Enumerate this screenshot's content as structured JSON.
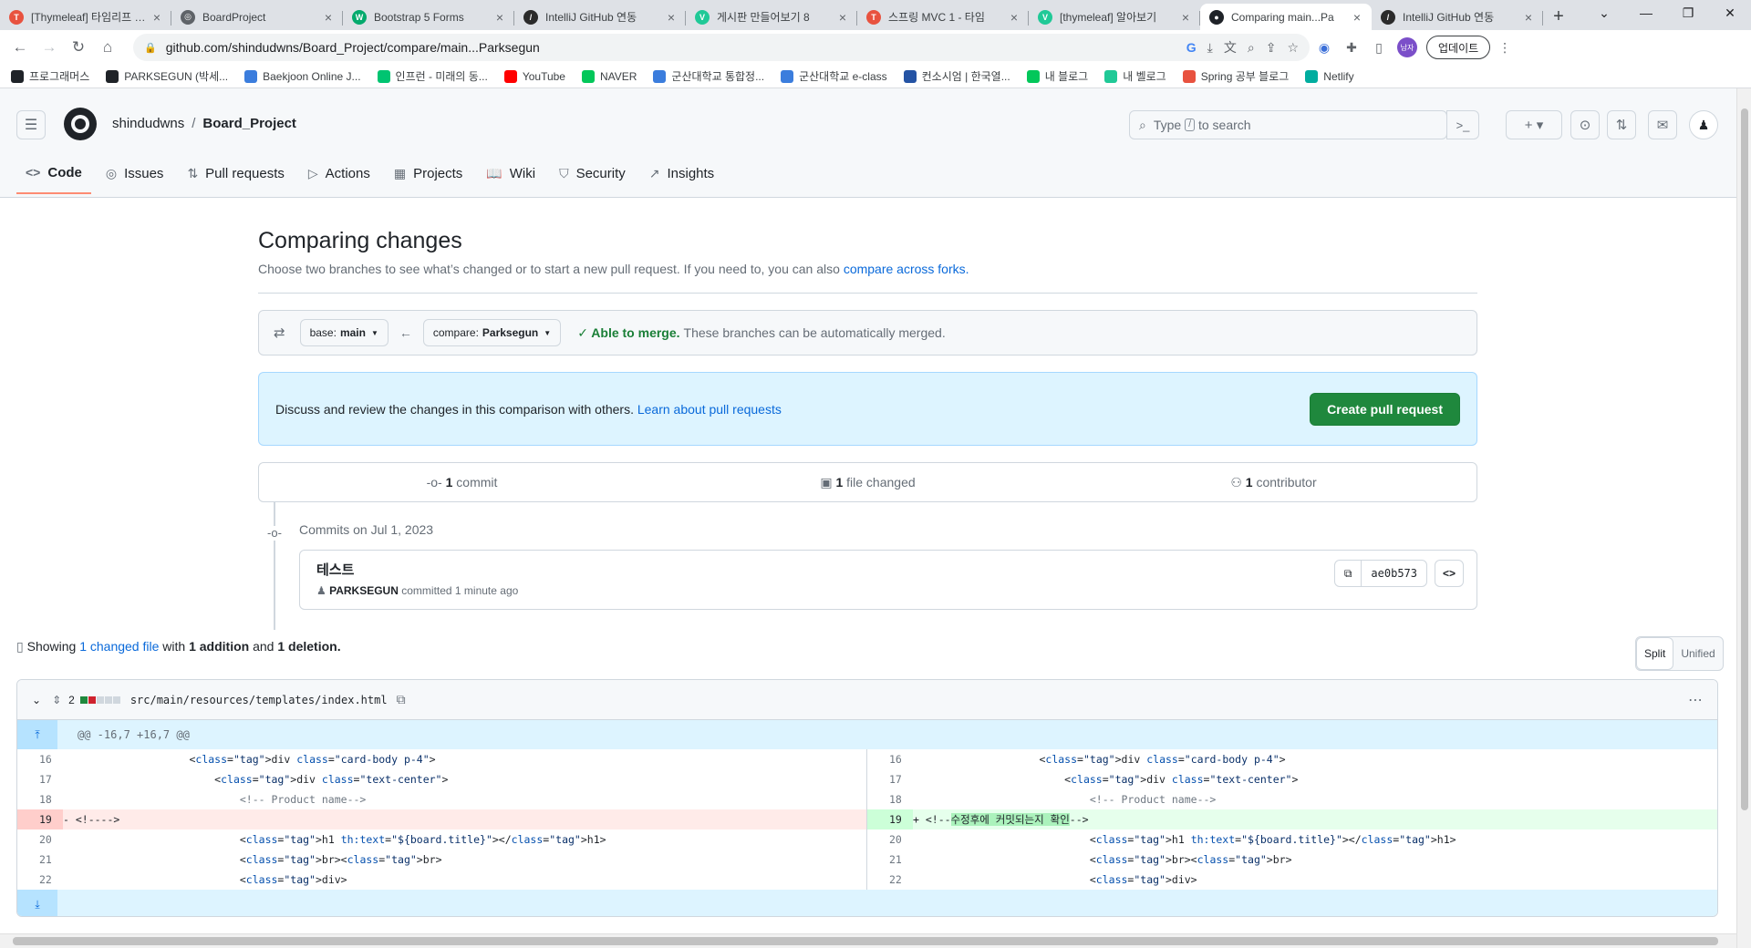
{
  "browser": {
    "tabs": [
      {
        "title": "[Thymeleaf] 타임리프 문법",
        "favicon_color": "#e8523f",
        "favicon_glyph": "T"
      },
      {
        "title": "BoardProject",
        "favicon_color": "#5f6368",
        "favicon_glyph": "◎"
      },
      {
        "title": "Bootstrap 5 Forms",
        "favicon_color": "#04aa6d",
        "favicon_glyph": "W"
      },
      {
        "title": "IntelliJ GitHub 연동",
        "favicon_color": "#2b2b2b",
        "favicon_glyph": "/"
      },
      {
        "title": "게시판 만들어보기 8",
        "favicon_color": "#20c997",
        "favicon_glyph": "V"
      },
      {
        "title": "스프링 MVC 1 - 타임",
        "favicon_color": "#e8523f",
        "favicon_glyph": "T"
      },
      {
        "title": "[thymeleaf] 알아보기",
        "favicon_color": "#20c997",
        "favicon_glyph": "V"
      },
      {
        "title": "Comparing main...Pa",
        "favicon_color": "#1f2328",
        "favicon_glyph": "●"
      },
      {
        "title": "IntelliJ GitHub 연동",
        "favicon_color": "#2b2b2b",
        "favicon_glyph": "/"
      }
    ],
    "active_tab_index": 7,
    "url": "github.com/shindudwns/Board_Project/compare/main...Parksegun",
    "profile_initials": "남자",
    "update_label": "업데이트",
    "bookmarks": [
      {
        "label": "프로그래머스",
        "color": "#1f2328"
      },
      {
        "label": "PARKSEGUN (박세...",
        "color": "#1f2328"
      },
      {
        "label": "Baekjoon Online J...",
        "color": "#3b7ddd"
      },
      {
        "label": "인프런 - 미래의 동...",
        "color": "#00c471"
      },
      {
        "label": "YouTube",
        "color": "#ff0000"
      },
      {
        "label": "NAVER",
        "color": "#03c75a"
      },
      {
        "label": "군산대학교 통합정...",
        "color": "#3b7ddd"
      },
      {
        "label": "군산대학교 e-class",
        "color": "#3b7ddd"
      },
      {
        "label": "컨소시엄 | 한국열...",
        "color": "#2453a4"
      },
      {
        "label": "내 블로그",
        "color": "#03c75a"
      },
      {
        "label": "내 벨로그",
        "color": "#20c997"
      },
      {
        "label": "Spring 공부 블로그",
        "color": "#e8523f"
      },
      {
        "label": "Netlify",
        "color": "#00ad9f"
      }
    ]
  },
  "github": {
    "owner": "shindudwns",
    "repo": "Board_Project",
    "search_prefix": "Type",
    "search_key": "/",
    "search_suffix": "to search",
    "repo_tabs": [
      {
        "label": "Code",
        "icon": "<>",
        "selected": true
      },
      {
        "label": "Issues",
        "icon": "◎",
        "selected": false
      },
      {
        "label": "Pull requests",
        "icon": "⇅",
        "selected": false
      },
      {
        "label": "Actions",
        "icon": "▷",
        "selected": false
      },
      {
        "label": "Projects",
        "icon": "▦",
        "selected": false
      },
      {
        "label": "Wiki",
        "icon": "📖",
        "selected": false
      },
      {
        "label": "Security",
        "icon": "⛉",
        "selected": false
      },
      {
        "label": "Insights",
        "icon": "↗",
        "selected": false
      }
    ]
  },
  "compare": {
    "title": "Comparing changes",
    "subtitle": "Choose two branches to see what’s changed or to start a new pull request. If you need to, you can also",
    "subtitle_link": "compare across forks.",
    "base_prefix": "base:",
    "base_branch": "main",
    "compare_prefix": "compare:",
    "compare_branch": "Parksegun",
    "merge_status": "Able to merge.",
    "merge_detail": "These branches can be automatically merged.",
    "flash_text": "Discuss and review the changes in this comparison with others.",
    "flash_link": "Learn about pull requests",
    "create_pr_label": "Create pull request",
    "summary": {
      "commits_count": "1",
      "commits_label": "commit",
      "files_count": "1",
      "files_label": "file changed",
      "contributors_count": "1",
      "contributors_label": "contributor"
    },
    "commits_on": "Commits on Jul 1, 2023",
    "commit": {
      "title": "테스트",
      "author": "PARKSEGUN",
      "meta": "committed 1 minute ago",
      "sha": "ae0b573"
    },
    "showing_prefix": "Showing",
    "showing_link": "1 changed file",
    "showing_with": "with",
    "showing_additions": "1 addition",
    "showing_and": "and",
    "showing_deletions": "1 deletion.",
    "view_split": "Split",
    "view_unified": "Unified"
  },
  "diff": {
    "changes_count": "2",
    "file_path": "src/main/resources/templates/index.html",
    "hunk_header": "@@ -16,7 +16,7 @@",
    "rows": [
      {
        "l_num": "16",
        "l_code": "                    <div class=\"card-body p-4\">",
        "r_num": "16",
        "r_code": "                    <div class=\"card-body p-4\">",
        "type": "ctx"
      },
      {
        "l_num": "17",
        "l_code": "                        <div class=\"text-center\">",
        "r_num": "17",
        "r_code": "                        <div class=\"text-center\">",
        "type": "ctx"
      },
      {
        "l_num": "18",
        "l_code": "                            <!-- Product name-->",
        "r_num": "18",
        "r_code": "                            <!-- Product name-->",
        "type": "ctx"
      },
      {
        "l_num": "19",
        "l_code": "- <!---->",
        "r_num": "19",
        "r_code": "+ <!--수정후에 커밋되는지 확인-->",
        "type": "change"
      },
      {
        "l_num": "20",
        "l_code": "                            <h1 th:text=\"${board.title}\"></h1>",
        "r_num": "20",
        "r_code": "                            <h1 th:text=\"${board.title}\"></h1>",
        "type": "ctx"
      },
      {
        "l_num": "21",
        "l_code": "                            <br><br>",
        "r_num": "21",
        "r_code": "                            <br><br>",
        "type": "ctx"
      },
      {
        "l_num": "22",
        "l_code": "                            <div>",
        "r_num": "22",
        "r_code": "                            <div>",
        "type": "ctx"
      }
    ]
  }
}
